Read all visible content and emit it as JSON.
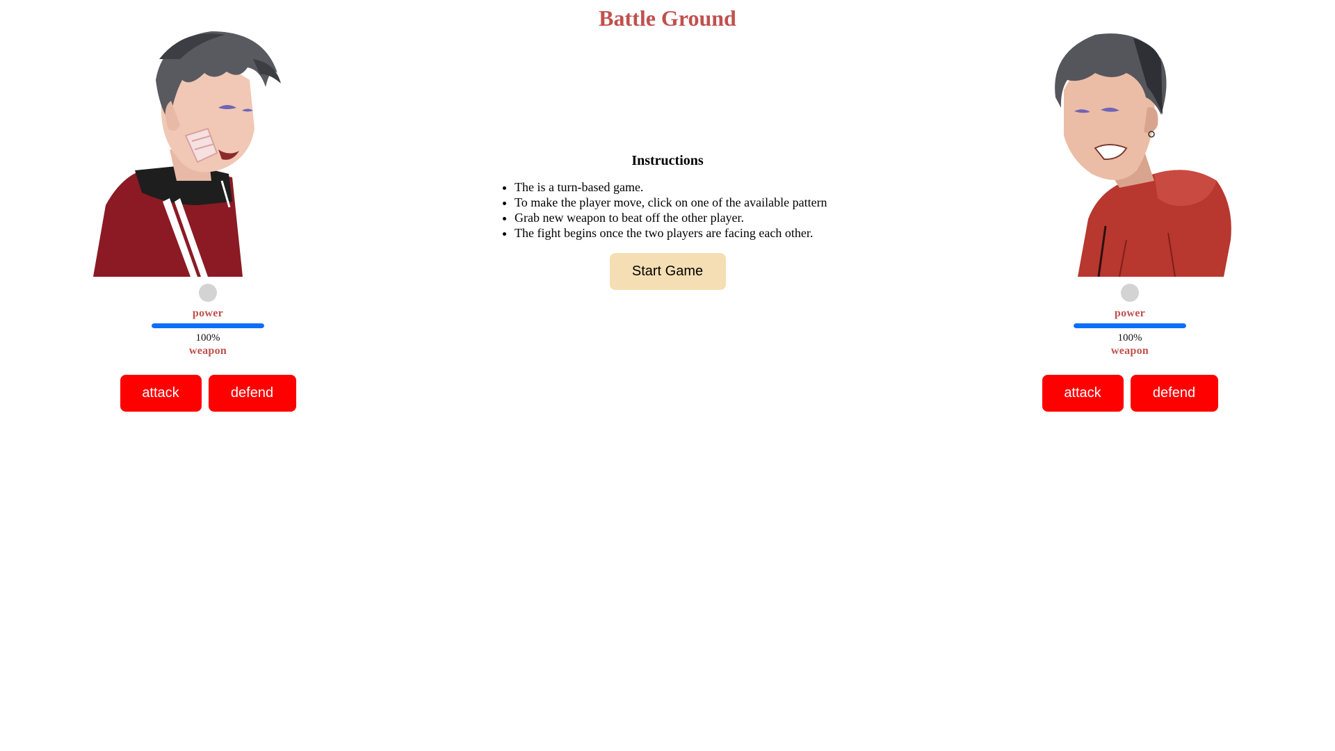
{
  "app": {
    "title": "Battle Ground",
    "title_color": "#c0504d"
  },
  "players": [
    {
      "portrait_icon": "anime-character-bandaged-red-jacket",
      "turn_indicator_color": "#d3d3d3",
      "power_label": "power",
      "power_value": "100%",
      "power_fraction": 1.0,
      "power_color": "#0d6efd",
      "weapon_label": "weapon",
      "attack_label": "attack",
      "defend_label": "defend"
    },
    {
      "portrait_icon": "anime-character-red-hoodie-grinning",
      "turn_indicator_color": "#d3d3d3",
      "power_label": "power",
      "power_value": "100%",
      "power_fraction": 1.0,
      "power_color": "#0d6efd",
      "weapon_label": "weapon",
      "attack_label": "attack",
      "defend_label": "defend"
    }
  ],
  "instructions": {
    "heading": "Instructions",
    "items": [
      "The is a turn-based game.",
      "To make the player move, click on one of the available pattern",
      "Grab new weapon to beat off the other player.",
      "The fight begins once the two players are facing each other."
    ]
  },
  "start_button": {
    "label": "Start Game",
    "color": "#f5deb3"
  },
  "colors": {
    "action_button": "#ff0000",
    "label": "#c0504d"
  }
}
